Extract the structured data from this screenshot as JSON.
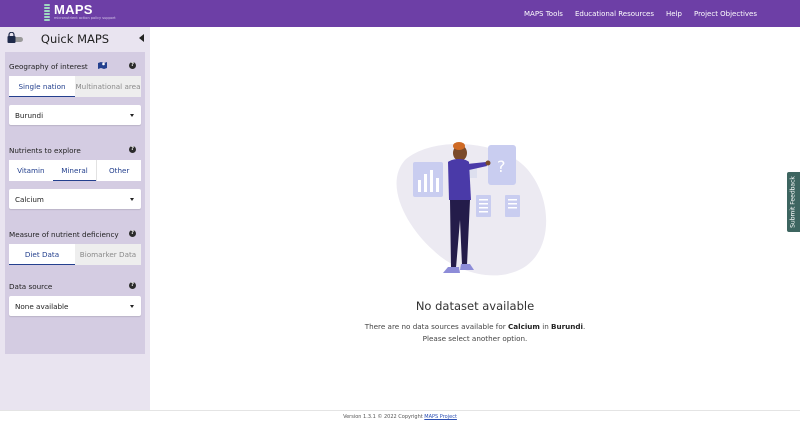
{
  "header": {
    "logo_title": "MAPS",
    "logo_subtitle": "micronutrient action policy support",
    "nav": [
      "MAPS Tools",
      "Educational Resources",
      "Help",
      "Project Objectives"
    ]
  },
  "sidebar": {
    "title": "Quick MAPS",
    "geography": {
      "label": "Geography of interest",
      "tabs": [
        "Single nation",
        "Multinational area"
      ],
      "active_tab": "Single nation",
      "selected": "Burundi"
    },
    "nutrients": {
      "label": "Nutrients to explore",
      "tabs": [
        "Vitamin",
        "Mineral",
        "Other"
      ],
      "active_tab": "Mineral",
      "selected": "Calcium"
    },
    "measure": {
      "label": "Measure of nutrient deficiency",
      "tabs": [
        "Diet Data",
        "Biomarker Data"
      ],
      "active_tab": "Diet Data"
    },
    "data_source": {
      "label": "Data source",
      "selected": "None available"
    },
    "help_glyph": "?"
  },
  "main": {
    "empty_title": "No dataset available",
    "msg_prefix": "There are no data sources available for ",
    "msg_nutrient": "Calcium",
    "msg_mid": " in ",
    "msg_country": "Burundi",
    "msg_suffix": ".",
    "msg_line2": "Please select another option."
  },
  "feedback_label": "Submit Feedback",
  "footer": {
    "text": "Version 1.3.1 © 2022 Copyright ",
    "link": "MAPS Project"
  },
  "colors": {
    "header_bg": "#6d3fa6",
    "sidebar_bg": "#e9e4f0",
    "panel_bg": "#d4cce2",
    "accent": "#24408e",
    "feedback_bg": "#3d6560"
  },
  "icons": {
    "sidebar_lock": "lock-toggle-icon",
    "collapse": "chevron-left-icon",
    "help": "question-circle-icon",
    "map": "map-icon",
    "dropdown": "caret-down-icon"
  }
}
